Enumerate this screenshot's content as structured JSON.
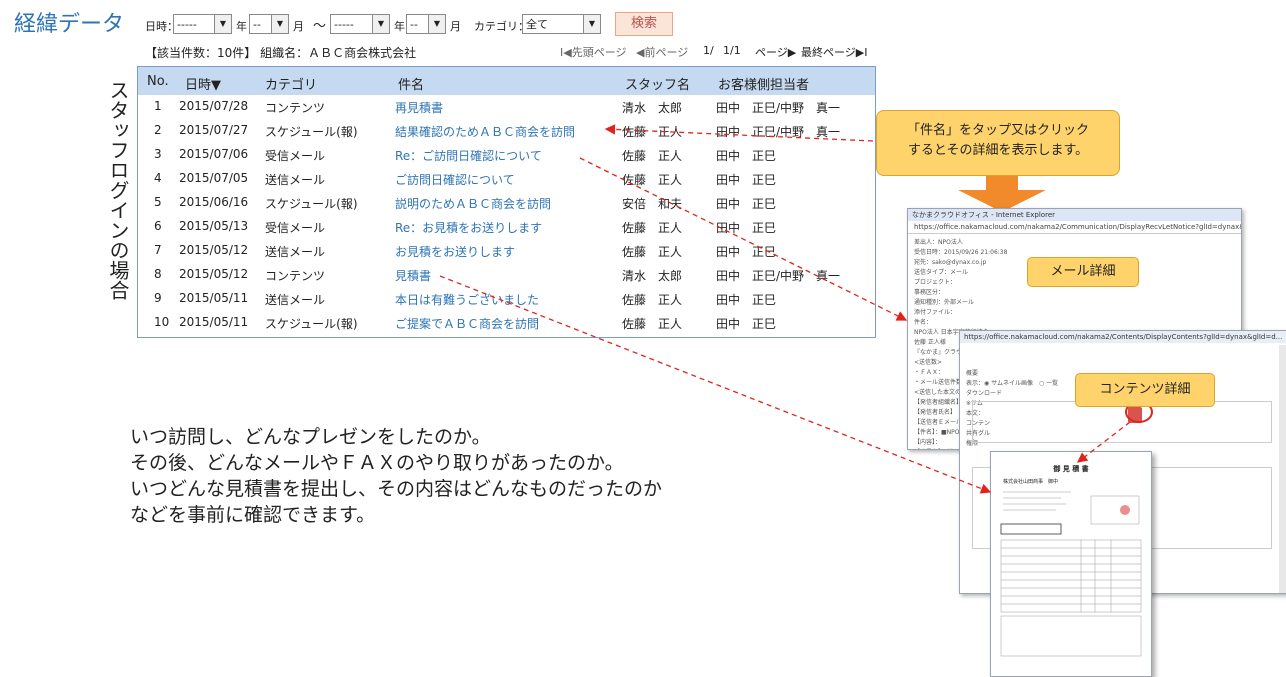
{
  "page_title": "経緯データ",
  "filter": {
    "date_label": "日時：",
    "year_from": "-----",
    "year_unit": "年",
    "month_from": "--",
    "month_unit": "月",
    "tilde": "～",
    "year_to": "-----",
    "month_to": "--",
    "category_label": "カテゴリ：",
    "category_value": "全て",
    "search_label": "検索"
  },
  "summary": "【該当件数：10件】 組織名：ＡＢＣ商会株式会社",
  "pager": {
    "first": "I◀先頭ページ",
    "prev": "◀前ページ",
    "current": "1/",
    "total": "1/1",
    "next": "ページ▶",
    "last": "最終ページ▶I"
  },
  "vertical_label": "スタッフログインの場合",
  "grid": {
    "headers": [
      "No.",
      "日時▼",
      "カテゴリ",
      "件名",
      "スタッフ名",
      "お客様側担当者"
    ],
    "rows": [
      {
        "no": "1",
        "date": "2015/07/28",
        "category": "コンテンツ",
        "subject": "再見積書",
        "staff": "清水　太郎",
        "customer": "田中　正巳/中野　真一"
      },
      {
        "no": "2",
        "date": "2015/07/27",
        "category": "スケジュール(報)",
        "subject": "結果確認のためＡＢＣ商会を訪問",
        "staff": "佐藤　正人",
        "customer": "田中　正巳/中野　真一"
      },
      {
        "no": "3",
        "date": "2015/07/06",
        "category": "受信メール",
        "subject": "Re：ご訪問日確認について",
        "staff": "佐藤　正人",
        "customer": "田中　正巳"
      },
      {
        "no": "4",
        "date": "2015/07/05",
        "category": "送信メール",
        "subject": "ご訪問日確認について",
        "staff": "佐藤　正人",
        "customer": "田中　正巳"
      },
      {
        "no": "5",
        "date": "2015/06/16",
        "category": "スケジュール(報)",
        "subject": "説明のためＡＢＣ商会を訪問",
        "staff": "安倍　和夫",
        "customer": "田中　正巳"
      },
      {
        "no": "6",
        "date": "2015/05/13",
        "category": "受信メール",
        "subject": "Re：お見積をお送りします",
        "staff": "佐藤　正人",
        "customer": "田中　正巳"
      },
      {
        "no": "7",
        "date": "2015/05/12",
        "category": "送信メール",
        "subject": "お見積をお送りします",
        "staff": "佐藤　正人",
        "customer": "田中　正巳"
      },
      {
        "no": "8",
        "date": "2015/05/12",
        "category": "コンテンツ",
        "subject": "見積書",
        "staff": "清水　太郎",
        "customer": "田中　正巳/中野　真一"
      },
      {
        "no": "9",
        "date": "2015/05/11",
        "category": "送信メール",
        "subject": "本日は有難うございました",
        "staff": "佐藤　正人",
        "customer": "田中　正巳"
      },
      {
        "no": "10",
        "date": "2015/05/11",
        "category": "スケジュール(報)",
        "subject": "ご提案でＡＢＣ商会を訪問",
        "staff": "佐藤　正人",
        "customer": "田中　正巳"
      }
    ]
  },
  "callout": {
    "line1": "「件名」をタップ又はクリック",
    "line2": "するとその詳細を表示します。"
  },
  "mail_window": {
    "title": "なかまクラウドオフィス - Internet Explorer",
    "url": "https://office.nakamacloud.com/nakama2/Communication/DisplayRecvLetNotice?glId=dynax&id=13424&bsType=0&displaymode=display",
    "tag": "メール詳細",
    "lines": [
      "差出人：NPO法人",
      "受信日時：2015/09/26 21:06:38",
      "宛先：sako@dynax.co.jp",
      "送信タイプ：メール",
      "プロジェクト：",
      "事務区分：",
      "通知種別：外部メール",
      "添付ファイル：",
      "件名：",
      "NPO法人 日本宇宙旅行協会",
      "佐藤 正人様",
      "『なかま』クラウ",
      "<送信数>",
      "・ＦＡＸ：",
      "・メール送信件数",
      "<送信した本文の",
      "【発信者組織名】",
      "【発信者氏名】",
      "【送信者Ｅメール】",
      "【件名】：■NPO",
      "【内容】：",
      "【会員名】：様"
    ]
  },
  "contents_window": {
    "url": "https://office.nakamacloud.com/nakama2/Contents/DisplayContents?glId=dynax&glId=d...",
    "tag": "コンテンツ詳細",
    "lines": [
      "概要",
      "表示：◉ サムネイル画像　○ 一覧",
      "ダウンロード",
      "※サム",
      "本文：",
      "コンテン",
      "共有グル",
      "権限"
    ]
  },
  "quote_doc": {
    "title": "御 見 積 書",
    "company": "株式会社山田商事　御中"
  },
  "body_text": [
    "いつ訪問し、どんなプレゼンをしたのか。",
    "その後、どんなメールやＦＡＸのやり取りがあったのか。",
    "いつどんな見積書を提出し、その内容はどんなものだったのか",
    "などを事前に確認できます。"
  ],
  "colors": {
    "link": "#2e74b5",
    "header_bg": "#c5d9f1",
    "callout": "#fed36b",
    "arrow": "#e0241b",
    "big_arrow": "#f08a2a"
  }
}
